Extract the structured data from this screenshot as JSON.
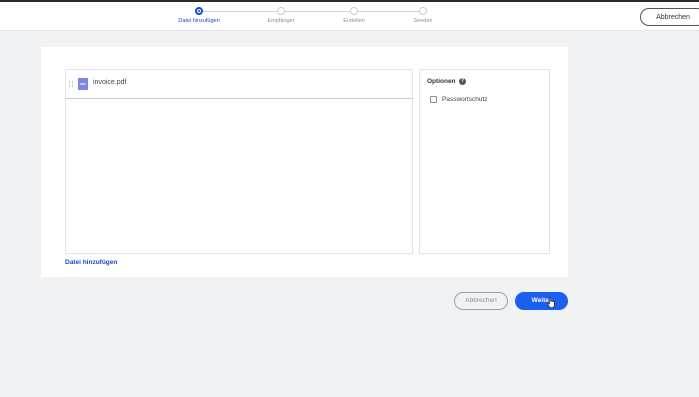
{
  "stepper": {
    "steps": [
      {
        "label": "Datei hinzufügen",
        "active": true
      },
      {
        "label": "Empfänger",
        "active": false
      },
      {
        "label": "Erstellen",
        "active": false
      },
      {
        "label": "Senden",
        "active": false
      }
    ]
  },
  "header": {
    "cancel_label": "Abbrechen"
  },
  "files": [
    {
      "name": "invoice.pdf",
      "icon": "pdf-file-icon",
      "icon_text": "PDF"
    }
  ],
  "options": {
    "title": "Optionen",
    "help_icon_text": "?",
    "password_label": "Passwortschutz",
    "password_checked": false
  },
  "add_file_label": "Datei hinzufügen",
  "footer": {
    "cancel_label": "Abbrechen",
    "next_label": "Weiter"
  },
  "colors": {
    "accent": "#1a5fee",
    "active_step": "#1a47d6",
    "background": "#f1f2f4"
  }
}
